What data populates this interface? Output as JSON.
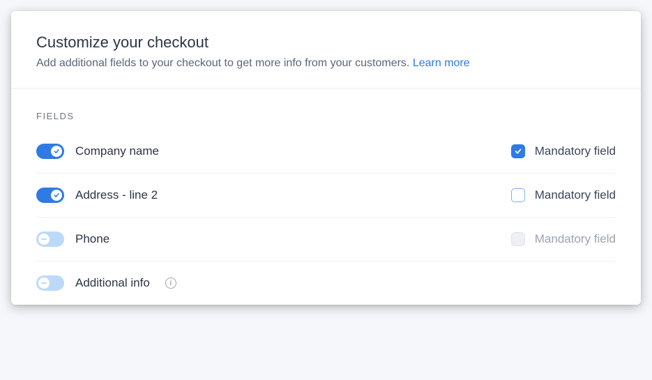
{
  "header": {
    "title": "Customize your checkout",
    "subtitle": "Add additional fields to your checkout to get more info from your customers.",
    "learn_more": "Learn more"
  },
  "section_label": "FIELDS",
  "mandatory_label": "Mandatory field",
  "fields": [
    {
      "label": "Company name",
      "enabled": true,
      "mandatory_checked": true,
      "has_info": false
    },
    {
      "label": "Address - line 2",
      "enabled": true,
      "mandatory_checked": false,
      "has_info": false
    },
    {
      "label": "Phone",
      "enabled": false,
      "mandatory_checked": false,
      "has_info": false
    },
    {
      "label": "Additional info",
      "enabled": false,
      "mandatory_checked": false,
      "has_info": true,
      "hide_mandatory": true
    }
  ]
}
